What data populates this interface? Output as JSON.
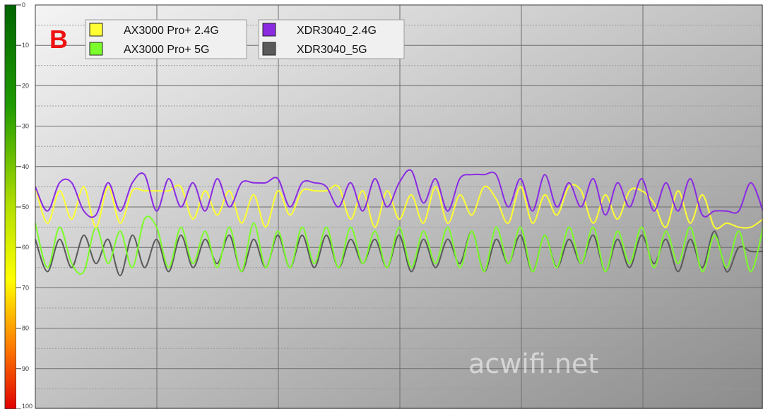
{
  "panel_label": "B",
  "watermark": "acwifi.net",
  "colors": {
    "panel_label": "#ee1111",
    "series_24_ax": "#ffff33",
    "series_5_ax": "#7cfc2a",
    "series_24_xdr": "#8a2be2",
    "series_5_xdr": "#5a5a5a"
  },
  "chart_data": {
    "type": "line",
    "title": "",
    "xlabel": "",
    "ylabel": "",
    "y_inverted": true,
    "ylim": [
      0,
      100
    ],
    "y_ticks": [
      "0",
      "10",
      "20",
      "30",
      "40",
      "50",
      "60",
      "70",
      "80",
      "90",
      "100"
    ],
    "grid": true,
    "legend_position": "top-left",
    "x": [
      0,
      1,
      2,
      3,
      4,
      5,
      6,
      7,
      8,
      9,
      10,
      11,
      12,
      13,
      14,
      15,
      16,
      17,
      18,
      19,
      20,
      21,
      22,
      23,
      24,
      25,
      26,
      27,
      28,
      29,
      30,
      31,
      32,
      33,
      34,
      35,
      36,
      37,
      38,
      39,
      40,
      41,
      42,
      43,
      44,
      45,
      46,
      47,
      48,
      49,
      50,
      51,
      52,
      53,
      54,
      55,
      56,
      57,
      58,
      59,
      60
    ],
    "series": [
      {
        "name": "AX3000 Pro+ 2.4G",
        "color_key": "series_24_ax",
        "values": [
          45,
          54,
          46,
          53,
          45,
          55,
          45,
          54,
          46,
          46,
          46,
          46,
          45,
          53,
          46,
          52,
          46,
          54,
          47,
          55,
          46,
          52,
          46,
          46,
          46,
          45,
          53,
          46,
          55,
          46,
          53,
          47,
          54,
          45,
          54,
          47,
          52,
          45,
          48,
          54,
          45,
          54,
          47,
          52,
          45,
          46,
          54,
          47,
          53,
          46,
          46,
          49,
          55,
          46,
          54,
          47,
          55,
          54,
          55,
          55,
          53
        ]
      },
      {
        "name": "AX3000 Pro+ 5G",
        "color_key": "series_5_ax",
        "values": [
          54,
          65,
          55,
          64,
          66,
          55,
          64,
          56,
          65,
          53,
          55,
          65,
          55,
          64,
          56,
          65,
          55,
          66,
          54,
          65,
          56,
          65,
          55,
          64,
          55,
          65,
          55,
          64,
          56,
          65,
          55,
          65,
          56,
          64,
          55,
          65,
          56,
          66,
          55,
          64,
          55,
          66,
          57,
          65,
          55,
          64,
          55,
          66,
          56,
          64,
          55,
          65,
          56,
          64,
          55,
          66,
          57,
          65,
          56,
          66,
          55
        ]
      },
      {
        "name": "XDR3040_2.4G",
        "color_key": "series_24_xdr",
        "values": [
          45,
          51,
          44,
          44,
          51,
          52,
          44,
          51,
          44,
          42,
          51,
          43,
          50,
          44,
          51,
          43,
          50,
          44,
          44,
          44,
          43,
          50,
          44,
          44,
          45,
          50,
          44,
          51,
          43,
          50,
          44,
          41,
          49,
          43,
          51,
          43,
          42,
          42,
          42,
          50,
          43,
          51,
          42,
          50,
          44,
          50,
          43,
          52,
          44,
          50,
          43,
          51,
          44,
          51,
          43,
          52,
          51,
          51,
          51,
          44,
          51
        ]
      },
      {
        "name": "XDR3040_5G",
        "color_key": "series_5_xdr",
        "values": [
          58,
          66,
          58,
          65,
          57,
          64,
          58,
          67,
          57,
          65,
          58,
          66,
          57,
          65,
          58,
          64,
          57,
          66,
          58,
          65,
          57,
          65,
          57,
          65,
          57,
          65,
          58,
          64,
          58,
          65,
          57,
          66,
          58,
          65,
          58,
          64,
          56,
          66,
          58,
          64,
          57,
          66,
          57,
          65,
          58,
          64,
          57,
          66,
          58,
          65,
          57,
          64,
          58,
          66,
          58,
          65,
          56,
          66,
          60,
          61,
          61
        ]
      }
    ]
  }
}
